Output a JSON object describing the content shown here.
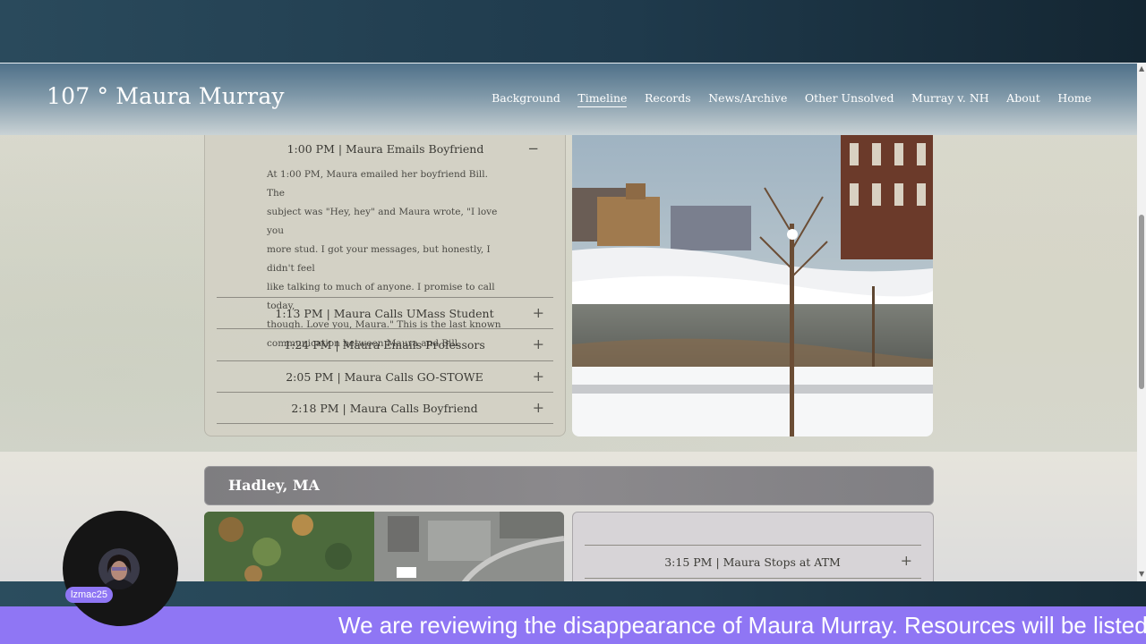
{
  "site": {
    "brand": "107 ° Maura Murray",
    "nav": [
      {
        "label": "Background"
      },
      {
        "label": "Timeline",
        "active": true
      },
      {
        "label": "Records"
      },
      {
        "label": "News/Archive"
      },
      {
        "label": "Other Unsolved"
      },
      {
        "label": "Murray v. NH"
      },
      {
        "label": "About"
      },
      {
        "label": "Home"
      }
    ]
  },
  "timeline": {
    "open_item": {
      "title": "1:00 PM | Maura Emails Boyfriend",
      "toggle": "−",
      "body_lines": [
        "At 1:00 PM, Maura emailed her boyfriend Bill. The",
        "subject was \"Hey, hey\" and Maura wrote, \"I love you",
        "more stud. I got your messages, but honestly, I didn't feel",
        "like talking to much of anyone. I promise to call today,",
        "though. Love you, Maura.\" This is the last known",
        "communication between Maura and Bill."
      ]
    },
    "items": [
      {
        "title": "1:13 PM | Maura Calls UMass Student",
        "toggle": "+"
      },
      {
        "title": "1:24 PM | Maura Emails Professors",
        "toggle": "+"
      },
      {
        "title": "2:05 PM | Maura Calls GO-STOWE",
        "toggle": "+"
      },
      {
        "title": "2:18 PM | Maura Calls Boyfriend",
        "toggle": "+"
      }
    ]
  },
  "section": {
    "title": "Hadley, MA",
    "items": [
      {
        "title": "3:15 PM | Maura Stops at ATM",
        "toggle": "+"
      }
    ]
  },
  "stream": {
    "username": "lzmac25",
    "ticker": "We are reviewing the disappearance of Maura Murray. Resources will be listed"
  },
  "colors": {
    "ticker_bg": "#8f76f4",
    "header_top": "#4f7089",
    "section_bar": "#838185"
  }
}
